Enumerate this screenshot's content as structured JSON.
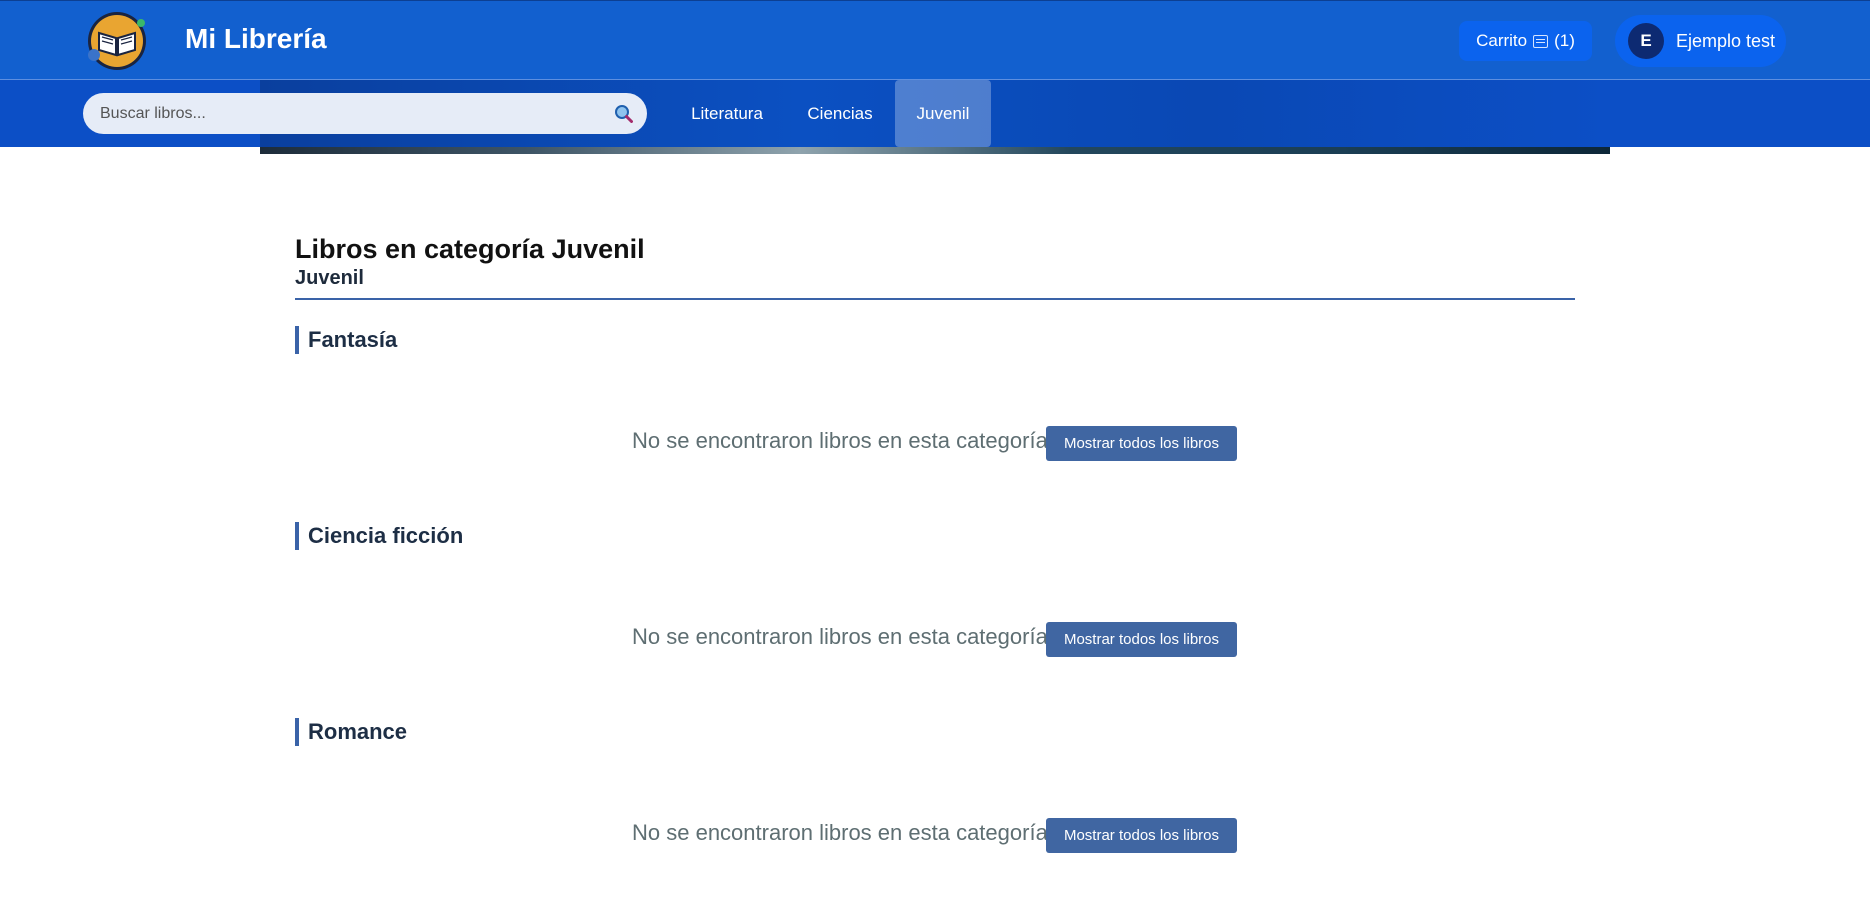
{
  "header": {
    "brand": "Mi Librería",
    "cart_label": "Carrito",
    "cart_count": "(1)",
    "user_initial": "E",
    "user_name": "Ejemplo test"
  },
  "nav": {
    "search_placeholder": "Buscar libros...",
    "items": [
      "Literatura",
      "Ciencias",
      "Juvenil"
    ],
    "active": "Juvenil"
  },
  "main": {
    "title": "Libros en categoría Juvenil",
    "subtitle": "Juvenil",
    "sections": [
      {
        "heading": "Fantasía",
        "empty_text": "No se encontraron libros en esta categoría",
        "button": "Mostrar todos los libros"
      },
      {
        "heading": "Ciencia ficción",
        "empty_text": "No se encontraron libros en esta categoría",
        "button": "Mostrar todos los libros"
      },
      {
        "heading": "Romance",
        "empty_text": "No se encontraron libros en esta categoría",
        "button": "Mostrar todos los libros"
      }
    ]
  },
  "icons": {
    "logo": "book-logo-icon",
    "cart": "cart-icon",
    "search": "search-icon"
  },
  "colors": {
    "header_bg": "#1260cf",
    "nav_bg": "#0c4fc6",
    "accent": "#3a63a8",
    "button_bg": "#4066a2",
    "cart_bg": "#0b63ee"
  }
}
